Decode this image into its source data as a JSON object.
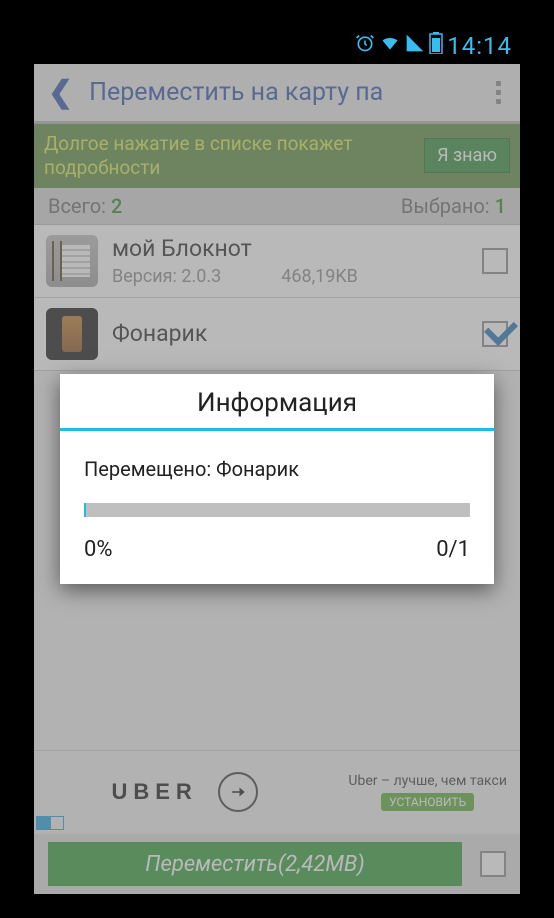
{
  "statusbar": {
    "time": "14:14"
  },
  "header": {
    "title": "Переместить на карту па"
  },
  "tip": {
    "text": "Долгое нажатие в списке покажет подробности",
    "button": "Я знаю"
  },
  "counts": {
    "total_label": "Всего: ",
    "total_value": "2",
    "selected_label": "Выбрано: ",
    "selected_value": "1"
  },
  "apps": [
    {
      "name": "мой Блокнот",
      "version_label": "Версия: 2.0.3",
      "size": "468,19KB"
    },
    {
      "name": "Фонарик"
    }
  ],
  "ad": {
    "logo": "UBER",
    "tagline": "Uber – лучше, чем такси",
    "install": "УСТАНОВИТЬ"
  },
  "footer": {
    "move_button": "Переместить(2,42MB)"
  },
  "dialog": {
    "title": "Информация",
    "moving_label": "Перемещено: Фонарик",
    "percent": "0%",
    "count": "0/1"
  }
}
